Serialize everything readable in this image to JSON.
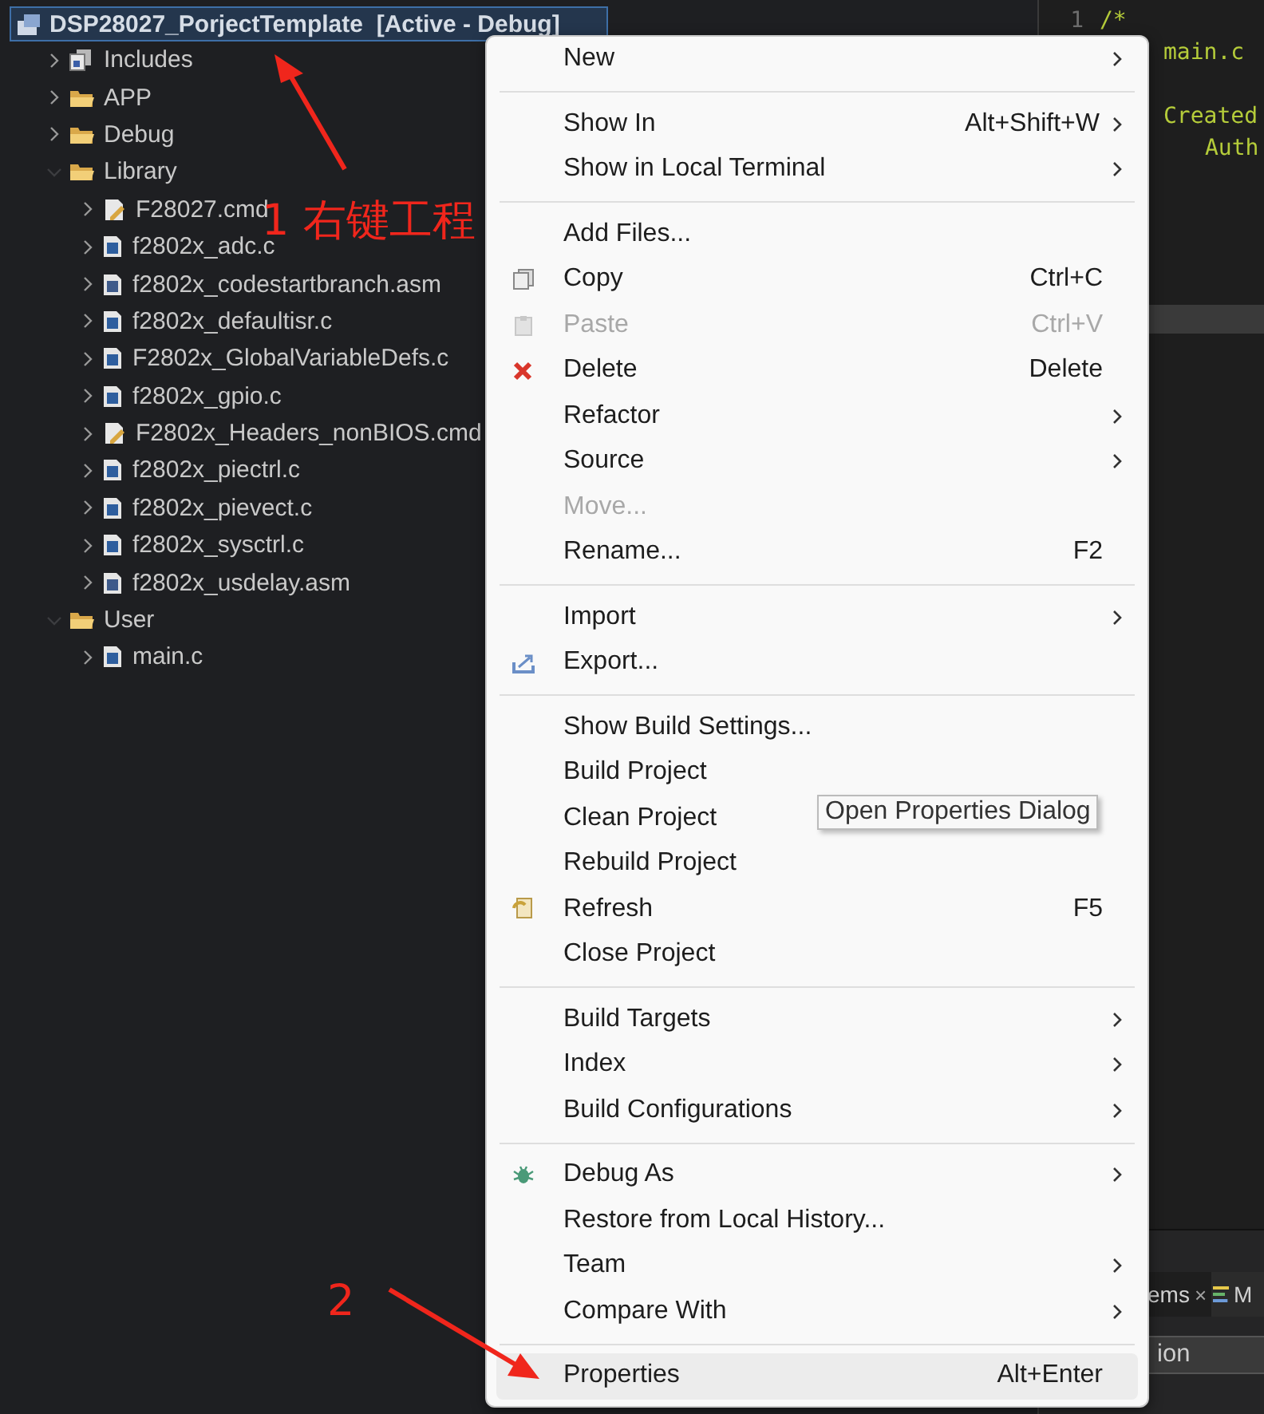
{
  "project_explorer": {
    "project": {
      "name": "DSP28027_PorjectTemplate  [Active - Debug]",
      "selected": true
    },
    "tree": [
      {
        "label": "Includes",
        "kind": "includes",
        "expanded": false
      },
      {
        "label": "APP",
        "kind": "folder",
        "expanded": false
      },
      {
        "label": "Debug",
        "kind": "folder",
        "expanded": false
      },
      {
        "label": "Library",
        "kind": "folder",
        "expanded": true,
        "children": [
          {
            "label": "F28027.cmd",
            "kind": "cmd",
            "expanded": false
          },
          {
            "label": "f2802x_adc.c",
            "kind": "c",
            "expanded": false
          },
          {
            "label": "f2802x_codestartbranch.asm",
            "kind": "asm",
            "expanded": false
          },
          {
            "label": "f2802x_defaultisr.c",
            "kind": "c",
            "expanded": false
          },
          {
            "label": "F2802x_GlobalVariableDefs.c",
            "kind": "c",
            "expanded": false
          },
          {
            "label": "f2802x_gpio.c",
            "kind": "c",
            "expanded": false
          },
          {
            "label": "F2802x_Headers_nonBIOS.cmd",
            "kind": "cmd",
            "expanded": false
          },
          {
            "label": "f2802x_piectrl.c",
            "kind": "c",
            "expanded": false
          },
          {
            "label": "f2802x_pievect.c",
            "kind": "c",
            "expanded": false
          },
          {
            "label": "f2802x_sysctrl.c",
            "kind": "c",
            "expanded": false
          },
          {
            "label": "f2802x_usdelay.asm",
            "kind": "asm",
            "expanded": false
          }
        ]
      },
      {
        "label": "User",
        "kind": "folder",
        "expanded": true,
        "children": [
          {
            "label": "main.c",
            "kind": "c",
            "expanded": false
          }
        ]
      }
    ]
  },
  "editor": {
    "line_numbers": [
      "1"
    ],
    "code_lines": [
      {
        "text": "/*",
        "kind": "start"
      },
      {
        "text": "main.c",
        "kind": "body"
      },
      {
        "text": "Created",
        "kind": "body"
      },
      {
        "text": "Auth",
        "kind": "nested"
      }
    ]
  },
  "bottom_panel": {
    "tabs": [
      {
        "label": "ems",
        "selected": true,
        "close": "×"
      },
      {
        "label": "M",
        "selected": false
      }
    ],
    "column_header": "ion"
  },
  "context_menu": {
    "items": [
      {
        "kind": "item",
        "label": "New",
        "submenu": true,
        "disabled": false,
        "selected": false
      },
      {
        "kind": "separator"
      },
      {
        "kind": "item",
        "label": "Show In",
        "shortcut": "Alt+Shift+W",
        "submenu": true,
        "disabled": false,
        "selected": false
      },
      {
        "kind": "item",
        "label": "Show in Local Terminal",
        "submenu": true,
        "disabled": false,
        "selected": false
      },
      {
        "kind": "separator"
      },
      {
        "kind": "item",
        "label": "Add Files...",
        "submenu": false,
        "disabled": false,
        "selected": false
      },
      {
        "kind": "copy",
        "label": "Copy",
        "shortcut": "Ctrl+C",
        "submenu": false,
        "disabled": false,
        "selected": false
      },
      {
        "kind": "paste",
        "label": "Paste",
        "shortcut": "Ctrl+V",
        "submenu": false,
        "disabled": true,
        "selected": false
      },
      {
        "kind": "delete",
        "label": "Delete",
        "shortcut": "Delete",
        "submenu": false,
        "disabled": false,
        "selected": false
      },
      {
        "kind": "item",
        "label": "Refactor",
        "submenu": true,
        "disabled": false,
        "selected": false
      },
      {
        "kind": "item",
        "label": "Source",
        "submenu": true,
        "disabled": false,
        "selected": false
      },
      {
        "kind": "item",
        "label": "Move...",
        "submenu": false,
        "disabled": true,
        "selected": false
      },
      {
        "kind": "item",
        "label": "Rename...",
        "shortcut": "F2",
        "submenu": false,
        "disabled": false,
        "selected": false
      },
      {
        "kind": "separator"
      },
      {
        "kind": "item",
        "label": "Import",
        "submenu": true,
        "disabled": false,
        "selected": false
      },
      {
        "kind": "export",
        "label": "Export...",
        "submenu": false,
        "disabled": false,
        "selected": false
      },
      {
        "kind": "separator"
      },
      {
        "kind": "item",
        "label": "Show Build Settings...",
        "submenu": false,
        "disabled": false,
        "selected": false
      },
      {
        "kind": "item",
        "label": "Build Project",
        "submenu": false,
        "disabled": false,
        "selected": false
      },
      {
        "kind": "item",
        "label": "Clean Project",
        "submenu": false,
        "disabled": false,
        "selected": false
      },
      {
        "kind": "item",
        "label": "Rebuild Project",
        "submenu": false,
        "disabled": false,
        "selected": false
      },
      {
        "kind": "refresh",
        "label": "Refresh",
        "shortcut": "F5",
        "submenu": false,
        "disabled": false,
        "selected": false
      },
      {
        "kind": "item",
        "label": "Close Project",
        "submenu": false,
        "disabled": false,
        "selected": false
      },
      {
        "kind": "separator"
      },
      {
        "kind": "item",
        "label": "Build Targets",
        "submenu": true,
        "disabled": false,
        "selected": false
      },
      {
        "kind": "item",
        "label": "Index",
        "submenu": true,
        "disabled": false,
        "selected": false
      },
      {
        "kind": "item",
        "label": "Build Configurations",
        "submenu": true,
        "disabled": false,
        "selected": false
      },
      {
        "kind": "separator"
      },
      {
        "kind": "debug",
        "label": "Debug As",
        "submenu": true,
        "disabled": false,
        "selected": false
      },
      {
        "kind": "item",
        "label": "Restore from Local History...",
        "submenu": false,
        "disabled": false,
        "selected": false
      },
      {
        "kind": "item",
        "label": "Team",
        "submenu": true,
        "disabled": false,
        "selected": false
      },
      {
        "kind": "item",
        "label": "Compare With",
        "submenu": true,
        "disabled": false,
        "selected": false
      },
      {
        "kind": "separator"
      },
      {
        "kind": "item",
        "label": "Properties",
        "shortcut": "Alt+Enter",
        "submenu": false,
        "disabled": false,
        "selected": true
      }
    ]
  },
  "tooltip": "Open Properties Dialog",
  "annotations": [
    {
      "text": "1 右键工程"
    },
    {
      "text": "2"
    }
  ]
}
